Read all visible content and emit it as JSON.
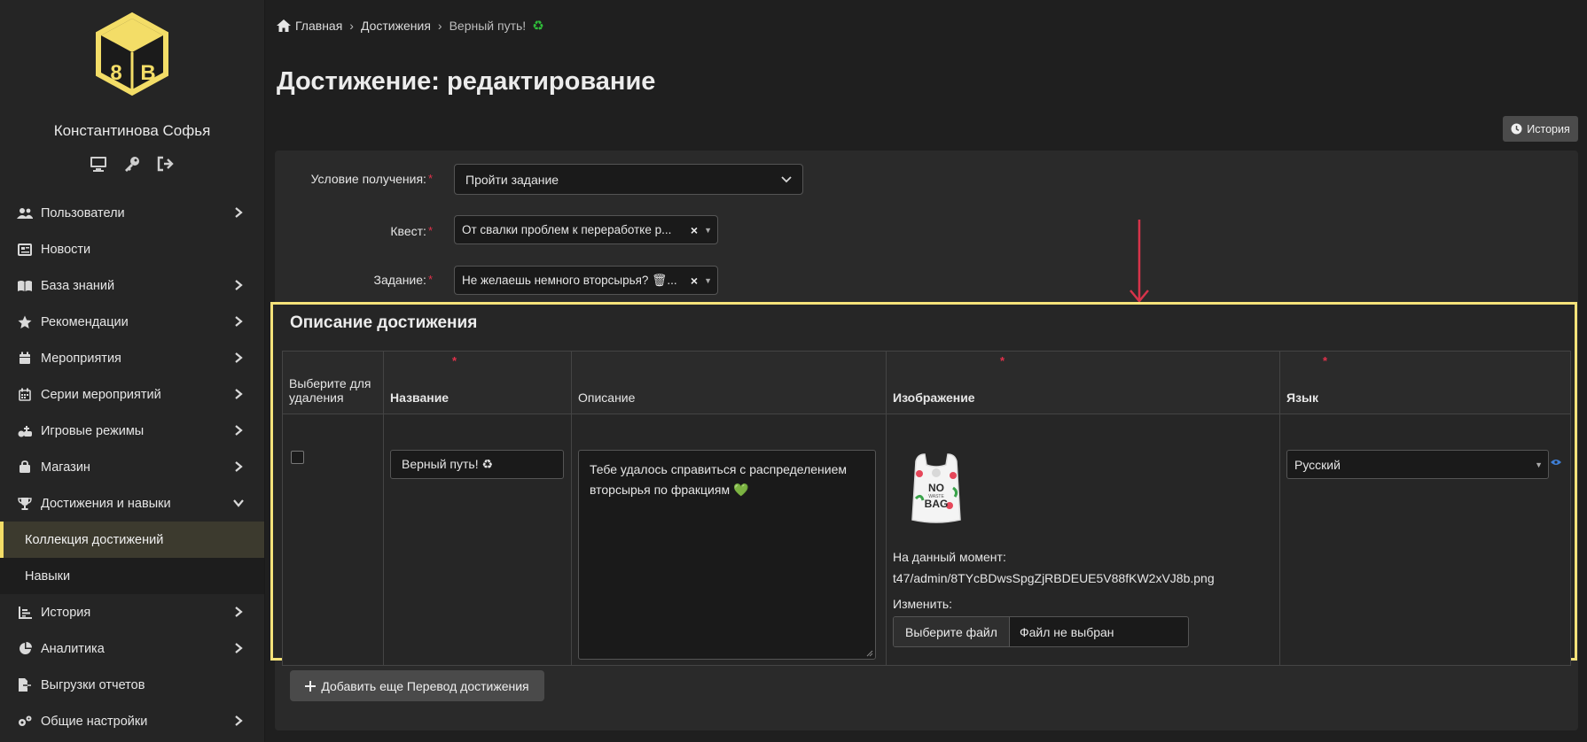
{
  "sidebar": {
    "user_name": "Константинова Софья",
    "user_icons": [
      "monitor-icon",
      "key-icon",
      "logout-icon"
    ],
    "items": [
      {
        "label": "Пользователи",
        "icon": "users-icon",
        "chevron": "right"
      },
      {
        "label": "Новости",
        "icon": "newspaper-icon",
        "chevron": ""
      },
      {
        "label": "База знаний",
        "icon": "book-icon",
        "chevron": "right"
      },
      {
        "label": "Рекомендации",
        "icon": "star-icon",
        "chevron": "right"
      },
      {
        "label": "Мероприятия",
        "icon": "calendar-icon",
        "chevron": "right"
      },
      {
        "label": "Серии мероприятий",
        "icon": "calendar-grid-icon",
        "chevron": "right"
      },
      {
        "label": "Игровые режимы",
        "icon": "game-icon",
        "chevron": "right"
      },
      {
        "label": "Магазин",
        "icon": "bag-icon",
        "chevron": "right"
      },
      {
        "label": "Достижения и навыки",
        "icon": "trophy-icon",
        "chevron": "down"
      },
      {
        "label": "Коллекция достижений",
        "sub": true,
        "active": true
      },
      {
        "label": "Навыки",
        "sub": true,
        "active": false
      },
      {
        "label": "История",
        "icon": "chart-icon",
        "chevron": "right"
      },
      {
        "label": "Аналитика",
        "icon": "pie-icon",
        "chevron": "right"
      },
      {
        "label": "Выгрузки отчетов",
        "icon": "file-export-icon",
        "chevron": ""
      },
      {
        "label": "Общие настройки",
        "icon": "gears-icon",
        "chevron": "right"
      }
    ]
  },
  "breadcrumb": {
    "home": "Главная",
    "section": "Достижения",
    "current": "Верный путь!",
    "current_emoji": "♻"
  },
  "page": {
    "title": "Достижение: редактирование",
    "history_button": "История"
  },
  "form": {
    "condition": {
      "label": "Условие получения:",
      "value": "Пройти задание"
    },
    "quest": {
      "label": "Квест:",
      "value": "От свалки проблем к переработке р..."
    },
    "task": {
      "label": "Задание:",
      "value": "Не желаешь немного вторсырья? 🗑..."
    }
  },
  "section": {
    "title": "Описание достижения",
    "columns": {
      "delete": "Выберите для удаления",
      "name": "Название",
      "description": "Описание",
      "image": "Изображение",
      "language": "Язык"
    },
    "row": {
      "name": "Верный путь! ♻",
      "description": "Тебе удалось справиться с распределением вторсырья по фракциям 💚",
      "image_current_label": "На данный момент:",
      "image_path": "t47/admin/8TYcBDwsSpgZjRBDEUE5V88fKW2xVJ8b.png",
      "image_change_label": "Изменить:",
      "file_button": "Выберите файл",
      "file_status": "Файл не выбран",
      "image_text_top": "NO",
      "image_text_mid": "WASTE",
      "image_text_bottom": "BAG",
      "language": "Русский"
    },
    "add_button": "Добавить еще Перевод достижения"
  },
  "colors": {
    "accent_yellow": "#f5e27a",
    "required_red": "#e0314b",
    "arrow_red": "#d6334a",
    "eco_green": "#2fbf3a"
  }
}
